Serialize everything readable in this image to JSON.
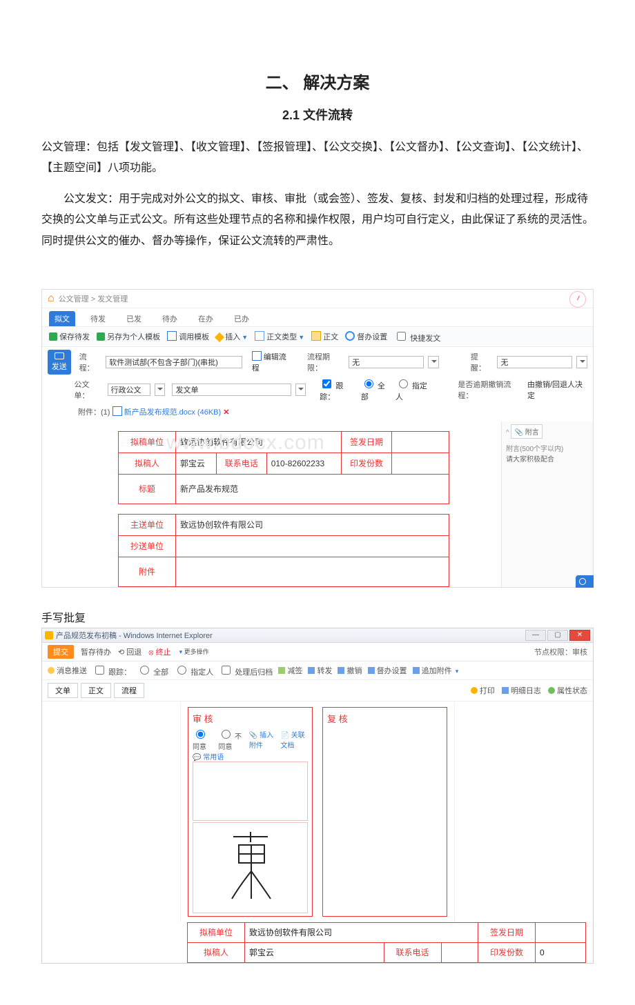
{
  "doc": {
    "h1": "二、 解决方案",
    "h2": "2.1 文件流转",
    "para1": "公文管理：包括【发文管理】、【收文管理】、【签报管理】、【公文交换】、【公文督办】、【公文查询】、【公文统计】、【主题空间】八项功能。",
    "para2": "公文发文：用于完成对外公文的拟文、审核、审批（或会签）、签发、复核、封发和归档的处理过程，形成待交换的公文单与正式公文。所有这些处理节点的名称和操作权限，用户均可自行定义，由此保证了系统的灵活性。同时提供公文的催办、督办等操作，保证公文流转的严肃性。",
    "caption2": "手写批复"
  },
  "s1": {
    "breadcrumb": "公文管理 > 发文管理",
    "tabs": [
      "拟文",
      "待发",
      "已发",
      "待办",
      "在办",
      "已办"
    ],
    "activeTab": 0,
    "toolbar": {
      "saveDraft": "保存待发",
      "saveTpl": "另存为个人模板",
      "callTpl": "调用模板",
      "insert": "插入",
      "bodyType": "正文类型",
      "body": "正文",
      "supervise": "督办设置",
      "quick": "快捷发文"
    },
    "send": "发送",
    "row1": {
      "procLabel": "流程：",
      "procValue": "软件测试部(不包含子部门)(串批)",
      "editProc": "编辑流程",
      "deadlineLabel": "流程期限：",
      "deadlineValue": "无",
      "remindLabel": "提醒：",
      "remindValue": "无"
    },
    "row2": {
      "formLabel": "公文单：",
      "formType": "行政公文",
      "formName": "发文单",
      "trackLabel": "跟踪：",
      "trackAll": "全部",
      "trackAssign": "指定人",
      "cancelLabel": "是否逾期撤销流程：",
      "cancelValue": "由撤销/回退人决定"
    },
    "attach": {
      "label": "附件：(1)",
      "file": "新产品发布规范.docx (46KB)"
    },
    "form": {
      "draftUnit": "拟稿单位",
      "draftUnitVal": "致远协创软件有限公司",
      "signDate": "签发日期",
      "drafter": "拟稿人",
      "drafterVal": "郭宝云",
      "phone": "联系电话",
      "phoneVal": "010-82602233",
      "copies": "印发份数",
      "title": "标题",
      "titleVal": "新产品发布规范",
      "mainSend": "主送单位",
      "mainSendVal": "致远协创软件有限公司",
      "cc": "抄送单位",
      "attach": "附件"
    },
    "side": {
      "attachHd": "附言",
      "limit": "附言(500个字以内)",
      "tip": "请大家积极配合"
    },
    "watermark": "www.bdocx.com"
  },
  "s2": {
    "title": "产品规范发布初稿 - Windows Internet Explorer",
    "tb1": {
      "submit": "提交",
      "tempSave": "暂存待办",
      "back": "回退",
      "stop": "终止",
      "more": "更多操作",
      "right": "节点权限：审核"
    },
    "tb2": {
      "msgPush": "消息推送",
      "track": "跟踪：",
      "all": "全部",
      "assign": "指定人",
      "archive": "处理后归档",
      "reduce": "减签",
      "forward": "转发",
      "revoke": "撤销",
      "supervise": "督办设置",
      "addAttach": "追加附件"
    },
    "subtabs": {
      "a": "文单",
      "b": "正文",
      "c": "流程",
      "print": "打印",
      "log": "明细日志",
      "attr": "属性状态"
    },
    "panel1": {
      "title": "审 核",
      "agree": "同意",
      "disagree": "不同意",
      "ins": "插入附件",
      "rel": "关联文档",
      "common": "常用语"
    },
    "panel2": {
      "title": "复 核"
    },
    "form": {
      "draftUnit": "拟稿单位",
      "draftUnitVal": "致远协创软件有限公司",
      "signDate": "签发日期",
      "drafter": "拟稿人",
      "drafterVal": "郭宝云",
      "phone": "联系电话",
      "copies": "印发份数",
      "copiesVal": "0"
    }
  }
}
